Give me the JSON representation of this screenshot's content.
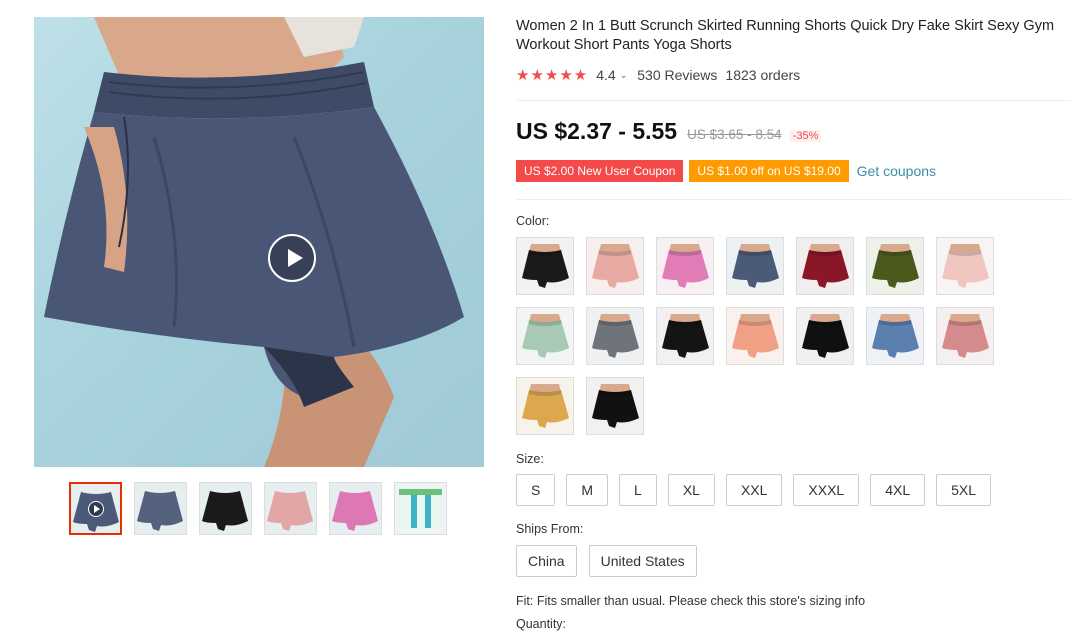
{
  "product": {
    "title": "Women 2 In 1 Butt Scrunch Skirted Running Shorts Quick Dry Fake Skirt Sexy Gym Workout Short Pants Yoga Shorts",
    "rating_stars": "★★★★★",
    "rating_value": "4.4",
    "rating_chevron": "⌄",
    "reviews": "530 Reviews",
    "orders": "1823 orders"
  },
  "price": {
    "current": "US $2.37 - 5.55",
    "original": "US $3.65 - 8.54",
    "discount": "-35%"
  },
  "coupons": {
    "new_user": "US $2.00 New User Coupon",
    "store": "US $1.00 off on US $19.00",
    "get_coupons": "Get coupons"
  },
  "color": {
    "label": "Color:",
    "swatches": [
      {
        "name": "black",
        "skirt": "#1a1a1a",
        "bg": "#f2f2f2"
      },
      {
        "name": "light-pink",
        "skirt": "#e8a9a2",
        "bg": "#f7efee"
      },
      {
        "name": "rose-pink",
        "skirt": "#e17cb7",
        "bg": "#f6f0f3"
      },
      {
        "name": "navy",
        "skirt": "#4b5a78",
        "bg": "#eef1f4"
      },
      {
        "name": "wine-red",
        "skirt": "#8a1728",
        "bg": "#f3eeee"
      },
      {
        "name": "army-green",
        "skirt": "#4a5a1c",
        "bg": "#eef1ea"
      },
      {
        "name": "blush-pink",
        "skirt": "#efc6c0",
        "bg": "#f8f4f3"
      },
      {
        "name": "mint-green",
        "skirt": "#a8c9b4",
        "bg": "#f2f5f3"
      },
      {
        "name": "grey",
        "skirt": "#6f747b",
        "bg": "#eef0f1"
      },
      {
        "name": "black-pocket",
        "skirt": "#141414",
        "bg": "#f1f1f1"
      },
      {
        "name": "coral",
        "skirt": "#f0a085",
        "bg": "#f8f1ee"
      },
      {
        "name": "black-2",
        "skirt": "#101010",
        "bg": "#f0f0f0"
      },
      {
        "name": "denim-blue",
        "skirt": "#5b7fae",
        "bg": "#eef2f7"
      },
      {
        "name": "dusty-pink",
        "skirt": "#d58b8d",
        "bg": "#f6efef"
      },
      {
        "name": "mustard",
        "skirt": "#dba84e",
        "bg": "#f7f2ea"
      },
      {
        "name": "black-3",
        "skirt": "#111111",
        "bg": "#f1f1f1"
      }
    ]
  },
  "size": {
    "label": "Size:",
    "options": [
      "S",
      "M",
      "L",
      "XL",
      "XXL",
      "XXXL",
      "4XL",
      "5XL"
    ]
  },
  "ships_from": {
    "label": "Ships From:",
    "options": [
      "China",
      "United States"
    ]
  },
  "fit_note": "Fit: Fits smaller than usual. Please check this store's sizing info",
  "quantity_label": "Quantity:",
  "gallery": {
    "thumbs": [
      {
        "name": "thumb-video-navy",
        "color": "#4b5a78",
        "video": true
      },
      {
        "name": "thumb-navy-back",
        "color": "#55627e",
        "video": false
      },
      {
        "name": "thumb-black",
        "color": "#1a1a1a",
        "video": false
      },
      {
        "name": "thumb-pink",
        "color": "#e3a6a6",
        "video": false
      },
      {
        "name": "thumb-rose",
        "color": "#dd78b5",
        "video": false
      },
      {
        "name": "thumb-size-chart",
        "color": "#3db2c7",
        "video": false
      }
    ]
  },
  "colors": {
    "accent_red": "#f44a4a",
    "coupon_orange": "#ff9b00",
    "link_teal": "#3a8da8",
    "active_border": "#e62e04"
  }
}
